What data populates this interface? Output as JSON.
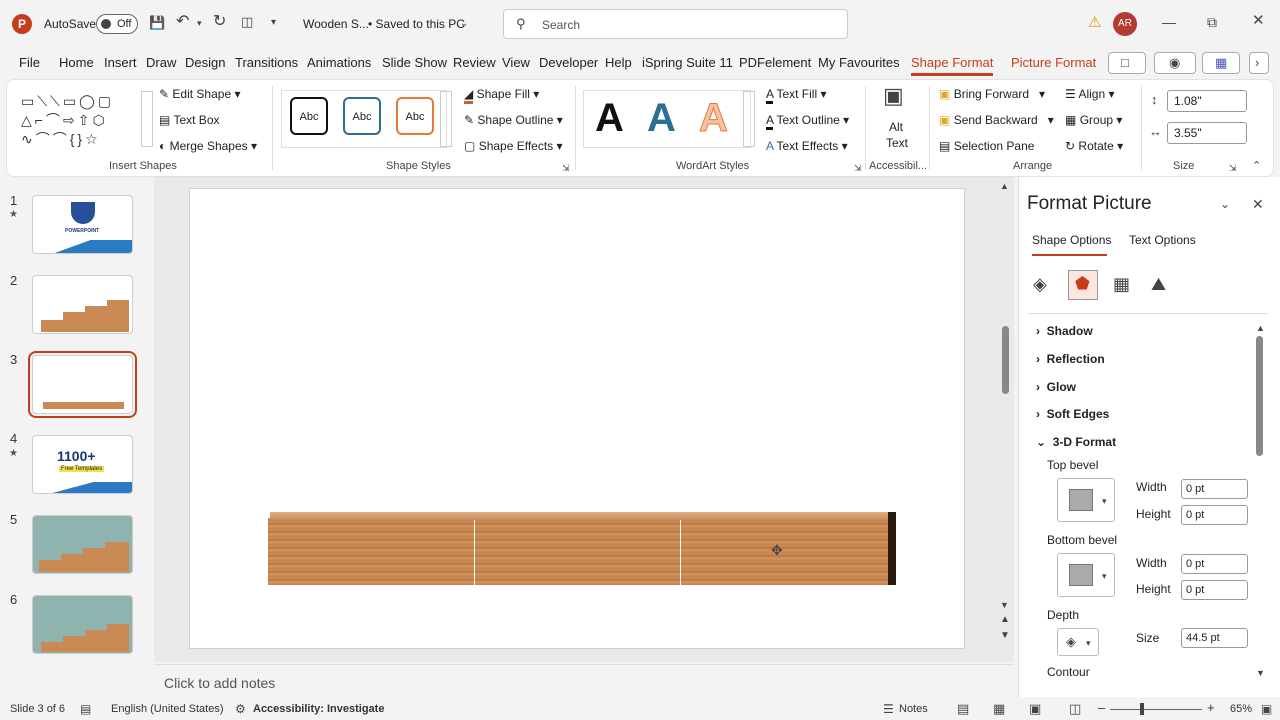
{
  "titlebar": {
    "app_logo": "P",
    "autosave_label": "AutoSave",
    "autosave_state": "Off",
    "file_title": "Wooden S...",
    "saved_status": "• Saved to this PC",
    "search_placeholder": "Search",
    "avatar_initials": "AR"
  },
  "tabs": [
    "File",
    "Home",
    "Insert",
    "Draw",
    "Design",
    "Transitions",
    "Animations",
    "Slide Show",
    "Review",
    "View",
    "Developer",
    "Help",
    "iSpring Suite 11",
    "PDFelement",
    "My Favourites",
    "Shape Format",
    "Picture Format"
  ],
  "ribbon": {
    "insert_shapes": {
      "label": "Insert Shapes",
      "edit_shape": "Edit Shape",
      "text_box": "Text Box",
      "merge_shapes": "Merge Shapes"
    },
    "shape_styles": {
      "label": "Shape Styles",
      "abc": "Abc",
      "shape_fill": "Shape Fill",
      "shape_outline": "Shape Outline",
      "shape_effects": "Shape Effects"
    },
    "wordart_styles": {
      "label": "WordArt Styles",
      "glyph": "A",
      "text_fill": "Text Fill",
      "text_outline": "Text Outline",
      "text_effects": "Text Effects"
    },
    "accessibility": {
      "label": "Accessibil...",
      "alt_text_1": "Alt",
      "alt_text_2": "Text"
    },
    "arrange": {
      "label": "Arrange",
      "bring_forward": "Bring Forward",
      "send_backward": "Send Backward",
      "selection_pane": "Selection Pane",
      "align": "Align",
      "group": "Group",
      "rotate": "Rotate"
    },
    "size": {
      "label": "Size",
      "height": "1.08\"",
      "width": "3.55\""
    }
  },
  "thumbnails": [
    {
      "num": "1",
      "star": true,
      "thumb_title": "POWERPOINT"
    },
    {
      "num": "2",
      "star": false
    },
    {
      "num": "3",
      "star": false,
      "selected": true
    },
    {
      "num": "4",
      "star": true,
      "thumb_title": "1100+",
      "thumb_sub": "Free Templates"
    },
    {
      "num": "5",
      "star": false
    },
    {
      "num": "6",
      "star": false
    }
  ],
  "notes_placeholder": "Click to add notes",
  "format_pane": {
    "title": "Format Picture",
    "tab_shape": "Shape Options",
    "tab_text": "Text Options",
    "sections": [
      "Shadow",
      "Reflection",
      "Glow",
      "Soft Edges",
      "3-D Format"
    ],
    "top_bevel": "Top bevel",
    "bottom_bevel": "Bottom bevel",
    "width_label": "Width",
    "height_label": "Height",
    "top_width": "0 pt",
    "top_height": "0 pt",
    "bottom_width": "0 pt",
    "bottom_height": "0 pt",
    "depth": "Depth",
    "size_label": "Size",
    "depth_size": "44.5 pt",
    "contour": "Contour"
  },
  "status": {
    "slide_of": "Slide 3 of 6",
    "language": "English (United States)",
    "accessibility": "Accessibility: Investigate",
    "notes": "Notes",
    "zoom": "65%"
  },
  "colors": {
    "accent": "#c43e1c",
    "wood": "#c2804c"
  }
}
